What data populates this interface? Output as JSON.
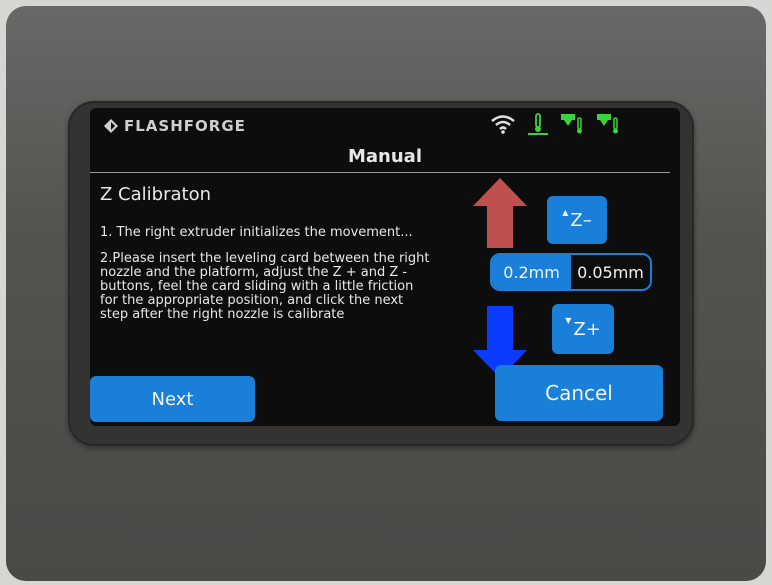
{
  "header": {
    "brand": "FLASHFORGE",
    "title": "Manual",
    "status_icons": [
      "wifi-icon",
      "platform-temp-icon",
      "left-nozzle-temp-icon",
      "right-nozzle-temp-icon"
    ]
  },
  "calibration": {
    "section_title": "Z Calibraton",
    "instructions": [
      "1. The right extruder initializes the movement...",
      "2.Please insert the leveling card between the right nozzle and the platform, adjust the Z + and Z - buttons, feel the card sliding with a little friction for the appropriate position, and click the next step after the right nozzle is calibrate"
    ]
  },
  "controls": {
    "z_minus_label": "Z–",
    "z_plus_label": "Z+",
    "step_options": [
      "0.2mm",
      "0.05mm"
    ],
    "selected_step": "0.2mm",
    "next_label": "Next",
    "cancel_label": "Cancel"
  },
  "annotations": {
    "up_arrow_color": "#c0504d",
    "down_arrow_color": "#0a3cff"
  },
  "colors": {
    "accent": "#1a7fd9",
    "status_green": "#3cd23c",
    "screen_bg": "#0d0d0d"
  }
}
